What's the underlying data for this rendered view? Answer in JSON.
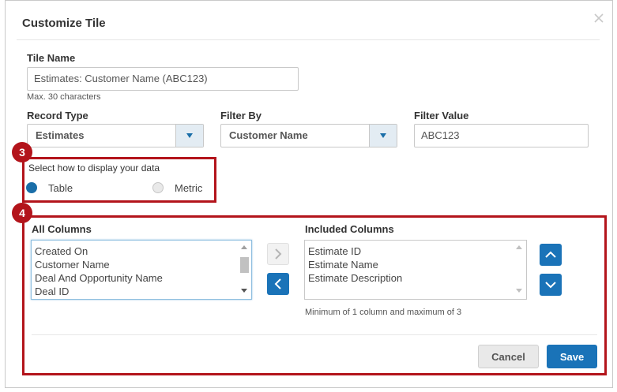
{
  "dialog": {
    "title": "Customize Tile",
    "close_icon": "close-icon"
  },
  "tile_name": {
    "label": "Tile Name",
    "value": "Estimates: Customer Name (ABC123)",
    "hint": "Max. 30 characters"
  },
  "record_type": {
    "label": "Record Type",
    "value": "Estimates"
  },
  "filter_by": {
    "label": "Filter By",
    "value": "Customer Name"
  },
  "filter_value": {
    "label": "Filter Value",
    "value": "ABC123"
  },
  "display": {
    "badge": "3",
    "label": "Select how to display your data",
    "options": [
      {
        "label": "Table",
        "selected": true
      },
      {
        "label": "Metric",
        "selected": false
      }
    ]
  },
  "columns": {
    "badge": "4",
    "all_label": "All Columns",
    "all_items": [
      "Created On",
      "Customer Name",
      "Deal And Opportunity Name",
      "Deal ID"
    ],
    "included_label": "Included Columns",
    "included_items": [
      "Estimate ID",
      "Estimate Name",
      "Estimate Description"
    ],
    "note": "Minimum of 1 column and maximum of 3",
    "add_icon": "chevron-right-icon",
    "remove_icon": "chevron-left-icon",
    "up_icon": "chevron-up-icon",
    "down_icon": "chevron-down-icon"
  },
  "footer": {
    "cancel_label": "Cancel",
    "save_label": "Save"
  },
  "colors": {
    "accent": "#1a73b8",
    "highlight": "#b3141b"
  }
}
